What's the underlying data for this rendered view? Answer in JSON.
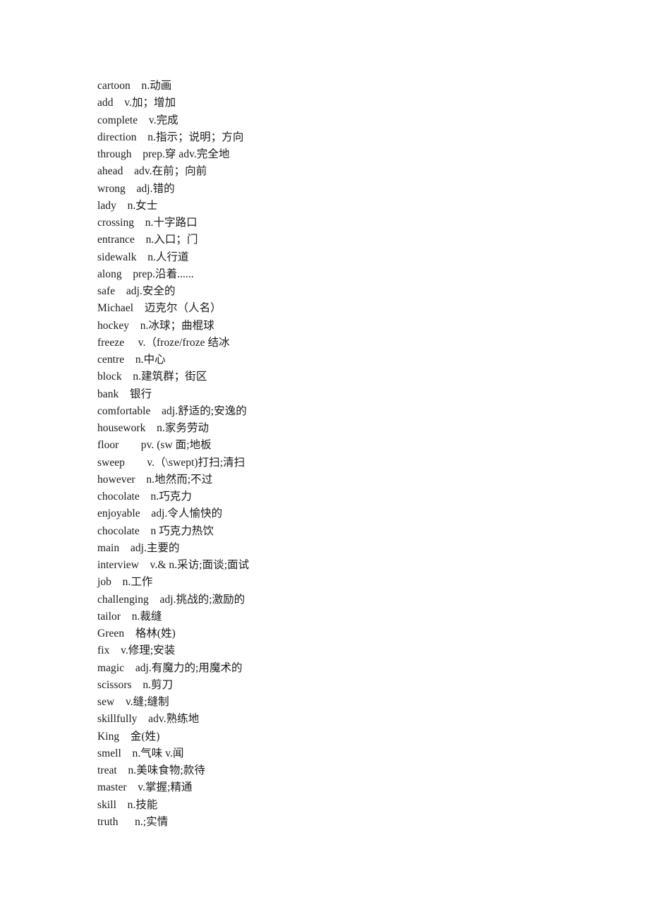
{
  "document": {
    "kind": "vocabulary-word-list",
    "language_pair": "English-Chinese",
    "entry_count": 44
  },
  "entries": [
    {
      "term": "cartoon",
      "gloss": "n.动画",
      "line": "cartoon    n.动画"
    },
    {
      "term": "add",
      "gloss": "v.加；增加",
      "line": "add    v.加；增加"
    },
    {
      "term": "complete",
      "gloss": "v.完成",
      "line": "complete    v.完成"
    },
    {
      "term": "direction",
      "gloss": "n.指示；说明；方向",
      "line": "direction    n.指示；说明；方向"
    },
    {
      "term": "through",
      "gloss": "prep.穿 adv.完全地",
      "line": "through    prep.穿 adv.完全地"
    },
    {
      "term": "ahead",
      "gloss": "adv.在前；向前",
      "line": "ahead    adv.在前；向前"
    },
    {
      "term": "wrong",
      "gloss": "adj.错的",
      "line": "wrong    adj.错的"
    },
    {
      "term": "lady",
      "gloss": "n.女士",
      "line": "lady    n.女士"
    },
    {
      "term": "crossing",
      "gloss": "n.十字路口",
      "line": "crossing    n.十字路口"
    },
    {
      "term": "entrance",
      "gloss": "n.入口；门",
      "line": "entrance    n.入口；门"
    },
    {
      "term": "sidewalk",
      "gloss": "n.人行道",
      "line": "sidewalk    n.人行道"
    },
    {
      "term": "along",
      "gloss": "prep.沿着......",
      "line": "along    prep.沿着......"
    },
    {
      "term": "safe",
      "gloss": "adj.安全的",
      "line": "safe    adj.安全的"
    },
    {
      "term": "Michael",
      "gloss": "迈克尔（人名）",
      "line": "Michael    迈克尔（人名）"
    },
    {
      "term": "hockey",
      "gloss": "n.冰球；曲棍球",
      "line": "hockey    n.冰球；曲棍球"
    },
    {
      "term": "freeze",
      "gloss": "v.（froze/froze 结冰",
      "line": "freeze     v.（froze/froze 结冰"
    },
    {
      "term": "centre",
      "gloss": "n.中心",
      "line": "centre    n.中心"
    },
    {
      "term": "block",
      "gloss": "n.建筑群；街区",
      "line": "block    n.建筑群；街区"
    },
    {
      "term": "bank",
      "gloss": "银行",
      "line": "bank    银行"
    },
    {
      "term": "comfortable",
      "gloss": "adj.舒适的;安逸的",
      "line": "comfortable    adj.舒适的;安逸的"
    },
    {
      "term": "housework",
      "gloss": "n.家务劳动",
      "line": "housework    n.家务劳动"
    },
    {
      "term": "floor",
      "gloss": "pv. (sw 面;地板",
      "line": "floor        pv. (sw 面;地板"
    },
    {
      "term": "sweep",
      "gloss": "v.（\\swept)打扫;清扫",
      "line": "sweep        v.（\\swept)打扫;清扫"
    },
    {
      "term": "however",
      "gloss": "n.地然而;不过",
      "line": "however    n.地然而;不过"
    },
    {
      "term": "chocolate",
      "gloss": "n.巧克力",
      "line": "chocolate    n.巧克力"
    },
    {
      "term": "enjoyable",
      "gloss": "adj.令人愉快的",
      "line": "enjoyable    adj.令人愉快的"
    },
    {
      "term": "chocolate",
      "gloss": "n 巧克力热饮",
      "line": "chocolate    n 巧克力热饮"
    },
    {
      "term": "main",
      "gloss": "adj.主要的",
      "line": "main    adj.主要的"
    },
    {
      "term": "interview",
      "gloss": "v.& n.采访;面谈;面试",
      "line": "interview    v.& n.采访;面谈;面试"
    },
    {
      "term": "job",
      "gloss": "n.工作",
      "line": "job    n.工作"
    },
    {
      "term": "challenging",
      "gloss": "adj.挑战的;激励的",
      "line": "challenging    adj.挑战的;激励的"
    },
    {
      "term": "tailor",
      "gloss": "n.裁缝",
      "line": "tailor    n.裁缝"
    },
    {
      "term": "Green",
      "gloss": "格林(姓)",
      "line": "Green    格林(姓)"
    },
    {
      "term": "fix",
      "gloss": "v.修理;安装",
      "line": "fix    v.修理;安装"
    },
    {
      "term": "magic",
      "gloss": "adj.有魔力的;用魔术的",
      "line": "magic    adj.有魔力的;用魔术的"
    },
    {
      "term": "scissors",
      "gloss": "n.剪刀",
      "line": "scissors    n.剪刀"
    },
    {
      "term": "sew",
      "gloss": "v.缝;缝制",
      "line": "sew    v.缝;缝制"
    },
    {
      "term": "skillfully",
      "gloss": "adv.熟练地",
      "line": "skillfully    adv.熟练地"
    },
    {
      "term": "King",
      "gloss": "金(姓)",
      "line": "King    金(姓)"
    },
    {
      "term": "smell",
      "gloss": "n.气味 v.闻",
      "line": "smell    n.气味 v.闻"
    },
    {
      "term": "treat",
      "gloss": "n.美味食物;款待",
      "line": "treat    n.美味食物;款待"
    },
    {
      "term": "master",
      "gloss": "v.掌握;精通",
      "line": "master    v.掌握;精通"
    },
    {
      "term": "skill",
      "gloss": "n.技能",
      "line": "skill    n.技能"
    },
    {
      "term": "truth",
      "gloss": "n.;实情",
      "line": "truth      n.;实情"
    }
  ]
}
